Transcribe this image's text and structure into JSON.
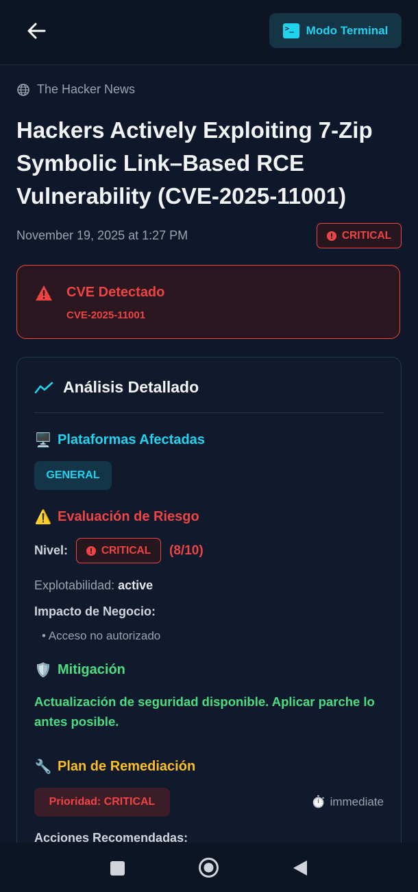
{
  "topbar": {
    "back_icon": "arrow-left-icon",
    "terminal_button_label": "Modo Terminal",
    "terminal_icon": "terminal-icon",
    "terminal_icon_glyph": ">_"
  },
  "article": {
    "source": "The Hacker News",
    "source_icon": "globe-icon",
    "title": "Hackers Actively Exploiting 7-Zip Symbolic Link–Based RCE Vulnerability (CVE-2025-11001)",
    "date": "November 19, 2025 at 1:27 PM",
    "severity_badge": "CRITICAL"
  },
  "cve_alert": {
    "icon": "warning-triangle-icon",
    "title": "CVE Detectado",
    "cve_id": "CVE-2025-11001"
  },
  "analysis": {
    "icon": "trending-chart-icon",
    "title": "Análisis Detallado",
    "platforms": {
      "emoji": "🖥️",
      "title": "Plataformas Afectadas",
      "chip": "GENERAL"
    },
    "risk": {
      "emoji": "⚠️",
      "title": "Evaluación de Riesgo",
      "level_label": "Nivel:",
      "level_badge": "CRITICAL",
      "score": "(8/10)",
      "exploitability_label": "Explotabilidad:",
      "exploitability_value": "active",
      "impact_label": "Impacto de Negocio:",
      "impact_items": [
        "• Acceso no autorizado"
      ]
    },
    "mitigation": {
      "emoji": "🛡️",
      "title": "Mitigación",
      "text": "Actualización de seguridad disponible. Aplicar parche lo antes posible."
    },
    "remediation": {
      "emoji": "🔧",
      "title": "Plan de Remediación",
      "priority_label": "Prioridad: CRITICAL",
      "timing_emoji": "⏱️",
      "timing": "immediate",
      "actions_label": "Acciones Recomendadas:"
    }
  },
  "colors": {
    "background": "#0f172a",
    "accent_cyan": "#22d3ee",
    "critical_red": "#ef4444",
    "mitigation_green": "#4ade80",
    "remediation_yellow": "#fbbf24"
  },
  "navbar": {
    "recent_icon": "square-recents-icon",
    "home_icon": "circle-home-icon",
    "back_icon": "triangle-back-icon"
  }
}
